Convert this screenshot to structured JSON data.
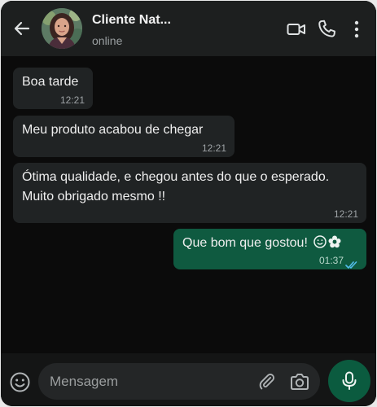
{
  "header": {
    "contact_name": "Cliente Nat...",
    "status": "online"
  },
  "messages": [
    {
      "direction": "incoming",
      "text": "Boa tarde",
      "time": "12:21"
    },
    {
      "direction": "incoming",
      "text": "Meu produto acabou de chegar",
      "time": "12:21"
    },
    {
      "direction": "incoming",
      "text": "Ótima qualidade, e chegou antes do que o esperado. Muito obrigado mesmo !!",
      "time": "12:21"
    },
    {
      "direction": "outgoing",
      "text": "Que bom que gostou!",
      "time": "01:37",
      "read": true
    }
  ],
  "composer": {
    "placeholder": "Mensagem"
  },
  "colors": {
    "incoming_bubble": "#202324",
    "outgoing_bubble": "#0f5a40",
    "read_ticks": "#53bdeb",
    "accent_button": "#0b5b3f"
  },
  "icons": {
    "back": "arrow-left-icon",
    "video": "video-camera-icon",
    "phone": "phone-icon",
    "menu": "more-vertical-icon",
    "emoji": "emoji-icon",
    "attach": "paperclip-icon",
    "camera": "camera-icon",
    "mic": "microphone-icon"
  }
}
